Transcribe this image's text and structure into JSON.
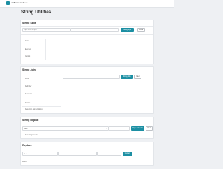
{
  "header": {
    "brand": "JetBrains Dev",
    "crumb": "Tools"
  },
  "page": {
    "title": "String Utilities"
  },
  "split": {
    "title": "String Split",
    "input_placeholder": "Input String to Split",
    "delimiter_placeholder": "",
    "split_button": "String Split",
    "clear_button": "Clear",
    "outputs": [
      "Index",
      "Element",
      "Output"
    ]
  },
  "join": {
    "title": "String Join",
    "fields": [
      "Prefix",
      "Delimiter",
      "Elements",
      "Postfix"
    ],
    "join_button": "String Join",
    "clear_button": "Clear",
    "output_label": "Output",
    "result_label": "Resulting Joined String"
  },
  "repeat": {
    "title": "String Repeat",
    "mode_label": "Mode",
    "repeat_button": "Repeat Result",
    "clear_button": "Clear",
    "result_label": "Resulting Result"
  },
  "replace": {
    "title": "Replace",
    "mode_label": "Mode",
    "replace_button": "Replace",
    "result_label": "Result"
  },
  "colors": {
    "accent": "#1c8fa3"
  }
}
